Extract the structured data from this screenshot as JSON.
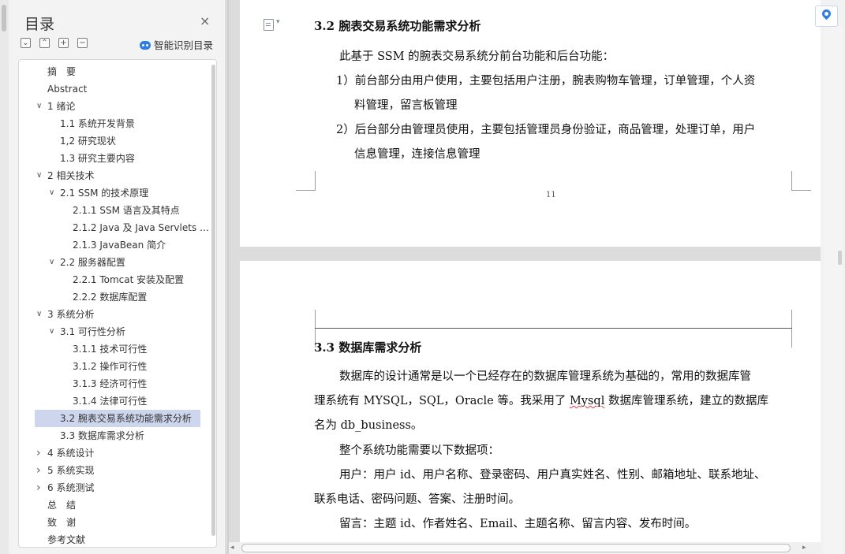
{
  "toc": {
    "title": "目录",
    "close_glyph": "×",
    "tools": [
      {
        "name": "collapse-all-button",
        "glyph": "⌄"
      },
      {
        "name": "expand-all-button",
        "glyph": "⌃"
      },
      {
        "name": "add-entry-button",
        "glyph": "+"
      },
      {
        "name": "remove-entry-button",
        "glyph": "−"
      }
    ],
    "smart_label": "智能识别目录",
    "items": [
      {
        "label": "摘　要",
        "level": 0,
        "caret": ""
      },
      {
        "label": "Abstract",
        "level": 0,
        "caret": ""
      },
      {
        "label": "1 绪论",
        "level": 0,
        "caret": "down"
      },
      {
        "label": "1.1 系统开发背景",
        "level": 1,
        "caret": ""
      },
      {
        "label": "1,2 研究现状",
        "level": 1,
        "caret": ""
      },
      {
        "label": "1.3 研究主要内容",
        "level": 1,
        "caret": ""
      },
      {
        "label": "2 相关技术",
        "level": 0,
        "caret": "down"
      },
      {
        "label": "2.1 SSM 的技术原理",
        "level": 1,
        "caret": "down"
      },
      {
        "label": "2.1.1 SSM 语言及其特点",
        "level": 2,
        "caret": ""
      },
      {
        "label": "2.1.2 Java 及 Java Servlets …",
        "level": 2,
        "caret": ""
      },
      {
        "label": "2.1.3 JavaBean 简介",
        "level": 2,
        "caret": ""
      },
      {
        "label": "2.2 服务器配置",
        "level": 1,
        "caret": "down"
      },
      {
        "label": "2.2.1 Tomcat 安装及配置",
        "level": 2,
        "caret": ""
      },
      {
        "label": "2.2.2 数据库配置",
        "level": 2,
        "caret": ""
      },
      {
        "label": "3 系统分析",
        "level": 0,
        "caret": "down"
      },
      {
        "label": "3.1 可行性分析",
        "level": 1,
        "caret": "down"
      },
      {
        "label": "3.1.1 技术可行性",
        "level": 2,
        "caret": ""
      },
      {
        "label": "3.1.2 操作可行性",
        "level": 2,
        "caret": ""
      },
      {
        "label": "3.1.3 经济可行性",
        "level": 2,
        "caret": ""
      },
      {
        "label": "3.1.4 法律可行性",
        "level": 2,
        "caret": ""
      },
      {
        "label": "3.2 腕表交易系统功能需求分析",
        "level": 1,
        "caret": "",
        "selected": true
      },
      {
        "label": "3.3 数据库需求分析",
        "level": 1,
        "caret": ""
      },
      {
        "label": "4 系统设计",
        "level": 0,
        "caret": "right"
      },
      {
        "label": "5 系统实现",
        "level": 0,
        "caret": "right"
      },
      {
        "label": "6 系统测试",
        "level": 0,
        "caret": "right"
      },
      {
        "label": "总　结",
        "level": 0,
        "caret": ""
      },
      {
        "label": "致　谢",
        "level": 0,
        "caret": ""
      },
      {
        "label": "参考文献",
        "level": 0,
        "caret": ""
      }
    ]
  },
  "page1": {
    "heading": "3.2  腕表交易系统功能需求分析",
    "intro": "此基于 SSM 的腕表交易系统分前台功能和后台功能：",
    "item1_line1": "1）前台部分由用户使用，主要包括用户注册，腕表购物车管理，订单管理，个人资",
    "item1_line2": "料管理，留言板管理",
    "item2_line1": "2）后台部分由管理员使用，主要包括管理员身份验证，商品管理，处理订单，用户",
    "item2_line2": "信息管理，连接信息管理",
    "page_number": "11"
  },
  "page2": {
    "heading": "3.3  数据库需求分析",
    "p1_line1": "数据库的设计通常是以一个已经存在的数据库管理系统为基础的，常用的数据库管",
    "p1_line2": "理系统有 MYSQL，SQL，Oracle 等。我采用了 Mysql 数据库管理系统，建立的数据库",
    "p1_line3": "名为 db_business。",
    "p2": "整个系统功能需要以下数据项：",
    "p3_line1": "用户：用户 id、用户名称、登录密码、用户真实姓名、性别、邮箱地址、联系地址、",
    "p3_line2": "联系电话、密码问题、答案、注册时间。",
    "p4": "留言：主题 id、作者姓名、Email、主题名称、留言内容、发布时间。"
  },
  "colors": {
    "selected_bg": "#cdd6ec",
    "accent": "#2f7de1",
    "spell_error": "#e03b3b"
  }
}
